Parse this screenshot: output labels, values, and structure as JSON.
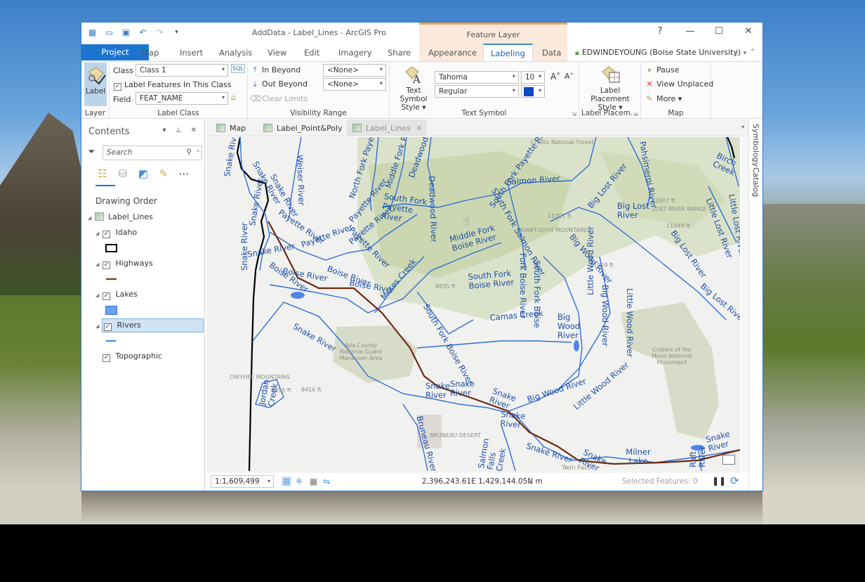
{
  "window": {
    "title": "AddData - Label_Lines - ArcGIS Pro",
    "context_group": "Feature Layer",
    "help": "?",
    "minimize": "—",
    "maximize": "☐",
    "close": "✕"
  },
  "quick_access": {
    "icons": [
      "new-project-icon",
      "open-project-icon",
      "save-project-icon",
      "undo-icon",
      "redo-icon",
      "customize-icon"
    ]
  },
  "ribbon_tabs": [
    {
      "label": "Project"
    },
    {
      "label": "Map"
    },
    {
      "label": "Insert"
    },
    {
      "label": "Analysis"
    },
    {
      "label": "View"
    },
    {
      "label": "Edit"
    },
    {
      "label": "Imagery"
    },
    {
      "label": "Share"
    },
    {
      "label": "Appearance"
    },
    {
      "label": "Labeling",
      "active": true
    },
    {
      "label": "Data"
    }
  ],
  "user": {
    "name": "EDWINDEYOUNG (Boise State University)",
    "dropdown": "▾",
    "bell": "🔔",
    "collapse": "˄"
  },
  "ribbon": {
    "layer_group": {
      "label_button": "Label",
      "group_label": "Layer"
    },
    "label_class": {
      "class_label": "Class",
      "class_value": "Class 1",
      "sql": "SQL",
      "label_features_checkbox": "Label Features In This Class",
      "label_features_checked": true,
      "field_label": "Field",
      "field_value": "FEAT_NAME",
      "group_label": "Label Class"
    },
    "visibility_range": {
      "in_beyond": "In Beyond",
      "out_beyond": "Out Beyond",
      "clear_limits": "Clear Limits",
      "in_value": "<None>",
      "out_value": "<None>",
      "group_label": "Visibility Range"
    },
    "text_symbol": {
      "style_button_line1": "Text Symbol",
      "style_button_line2": "Style ▾",
      "font": "Tahoma",
      "size": "10",
      "style": "Regular",
      "color": "#1048c8",
      "grow": "A˄",
      "shrink": "A˅",
      "group_label": "Text Symbol"
    },
    "label_placement": {
      "button_line1": "Label Placement",
      "button_line2": "Style ▾",
      "group_label": "Label Placem..."
    },
    "map_group": {
      "pause": "Pause",
      "view_unplaced": "View Unplaced",
      "more": "More ▾",
      "group_label": "Map"
    }
  },
  "contents": {
    "title": "Contents",
    "controls": "▾ ⊥ ✕",
    "search_placeholder": "Search",
    "drawing_order_title": "Drawing Order",
    "map_name": "Label_Lines",
    "layers": [
      {
        "name": "Idaho",
        "checked": true,
        "symbol": "black-outline-polygon"
      },
      {
        "name": "Highways",
        "checked": true,
        "symbol": "brown-line",
        "color": "#7a2a14"
      },
      {
        "name": "Lakes",
        "checked": true,
        "symbol": "blue-fill",
        "color": "#6aa2f5"
      },
      {
        "name": "Rivers",
        "checked": true,
        "symbol": "blue-line",
        "color": "#3e82e0",
        "selected": true
      },
      {
        "name": "Topographic",
        "checked": true
      }
    ]
  },
  "map_tabs": [
    {
      "label": "Map"
    },
    {
      "label": "Label_Point&Poly"
    },
    {
      "label": "Label_Lines",
      "active": true,
      "close": "✕"
    }
  ],
  "side_tabs": [
    "Symbology",
    "Catalog"
  ],
  "map": {
    "colors": {
      "river": "#2f6fd6",
      "highway": "#6e2a12",
      "boundary": "#000000",
      "label": "#1d4fa5"
    },
    "river_labels": [
      "Snake River",
      "Snake River",
      "Snake River",
      "Snake River",
      "Snake River",
      "Snake River",
      "Weiser River",
      "North Fork Payette River",
      "Middle Fork Payette River",
      "Deadwood River",
      "Deadwood River",
      "South Fork Payette River",
      "Payette River",
      "Payette River",
      "Payette River",
      "Payette River",
      "Payette River",
      "Boise River",
      "Boise River",
      "Boise River",
      "Boise River",
      "Mores Creek",
      "Middle Fork Boise River",
      "South Fork Boise River",
      "South Fork Boise River",
      "Salmon River",
      "South Fork Payette River",
      "South Fork Salmon River",
      "Big Lost River",
      "Big Lost River",
      "Big Lost River",
      "Big Lost River",
      "Pahsimeroi River",
      "Birch Creek",
      "Little Lost River",
      "Little Lost River",
      "Big Wood River",
      "Little Wood River",
      "Big Wood River",
      "Big Wood River",
      "Little Wood River",
      "Camas Creek",
      "Big Wood River",
      "Little Wood River",
      "Snake River",
      "Snake River",
      "Snake River",
      "Snake River",
      "Snake River",
      "Snake River",
      "Snake River",
      "Snake River",
      "Jordan Creek",
      "Bruneau River",
      "Salmon Falls Creek",
      "Milner Lake",
      "Raft River",
      "Fork Boise River",
      "South Fork Boise"
    ],
    "basemap_labels": [
      "Challis National Forest",
      "Ada County National Guard Maneuver Area",
      "Craters of the Moon National Monument",
      "OWYHEE MOUNTAINS",
      "BRUNEAU DESERT",
      "LOST RIVER RANGE",
      "SAWTOOTH MOUNTAINS",
      "Twin Falls",
      "8835 ft",
      "11791 ft",
      "12007 ft",
      "11049 ft",
      "11959 ft",
      "8055 ft",
      "8416 ft"
    ]
  },
  "status": {
    "scale": "1:1,609,499",
    "coordinates": "2,396,243.61E 1,429,144.05N m",
    "coord_dropdown": "⌄",
    "selected_features": "Selected Features: 0",
    "pause": "❚❚",
    "refresh": "⟳"
  }
}
